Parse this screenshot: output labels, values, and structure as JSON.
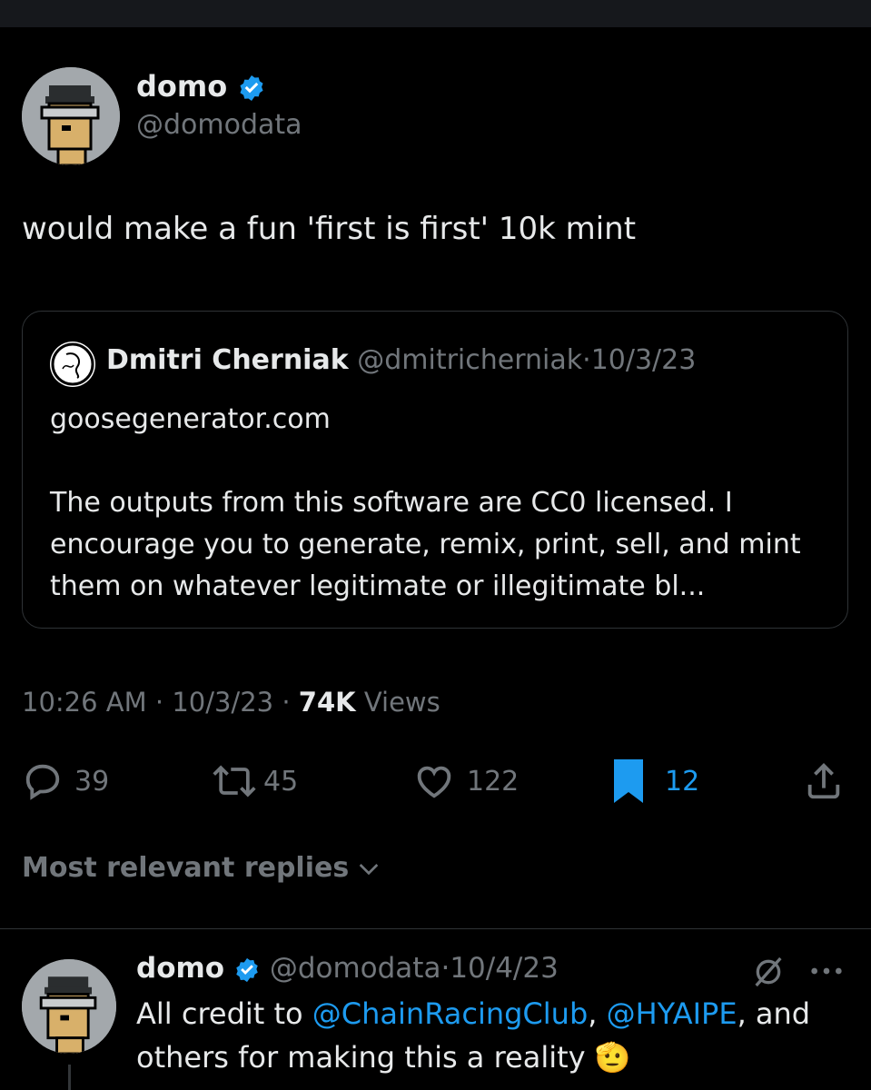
{
  "tweet": {
    "author_name": "domo",
    "author_handle": "@domodata",
    "text": "would make a fun 'first is first' 10k mint"
  },
  "quote": {
    "author_name": "Dmitri Cherniak",
    "author_handle": "@dmitricherniak",
    "separator": "·",
    "date": "10/3/23",
    "line1": "goosegenerator.com",
    "body": "The outputs from this software are CC0 licensed. I encourage you to generate, remix, print, sell, and mint them on whatever legitimate or illegitimate bl..."
  },
  "meta": {
    "time": "10:26 AM",
    "sep1": "·",
    "date": "10/3/23",
    "sep2": "·",
    "views_count": "74K",
    "views_label": "Views"
  },
  "actions": {
    "replies": "39",
    "reposts": "45",
    "likes": "122",
    "bookmarks": "12"
  },
  "replies_header": "Most relevant replies",
  "reply": {
    "author_name": "domo",
    "author_handle": "@domodata",
    "separator": "·",
    "date": "10/4/23",
    "text_before": "All credit to ",
    "mention1": "@ChainRacingClub",
    "text_mid": ", ",
    "mention2": "@HYAIPE",
    "text_after": ", and others for making this a reality 🫡"
  },
  "colors": {
    "background": "#000000",
    "accent": "#1d9bf0",
    "muted": "#71767b",
    "text": "#e7e9ea"
  },
  "icons": [
    "verified-badge-icon",
    "reply-icon",
    "repost-icon",
    "like-icon",
    "bookmark-icon",
    "share-icon",
    "chevron-down-icon",
    "grok-icon",
    "more-icon"
  ]
}
